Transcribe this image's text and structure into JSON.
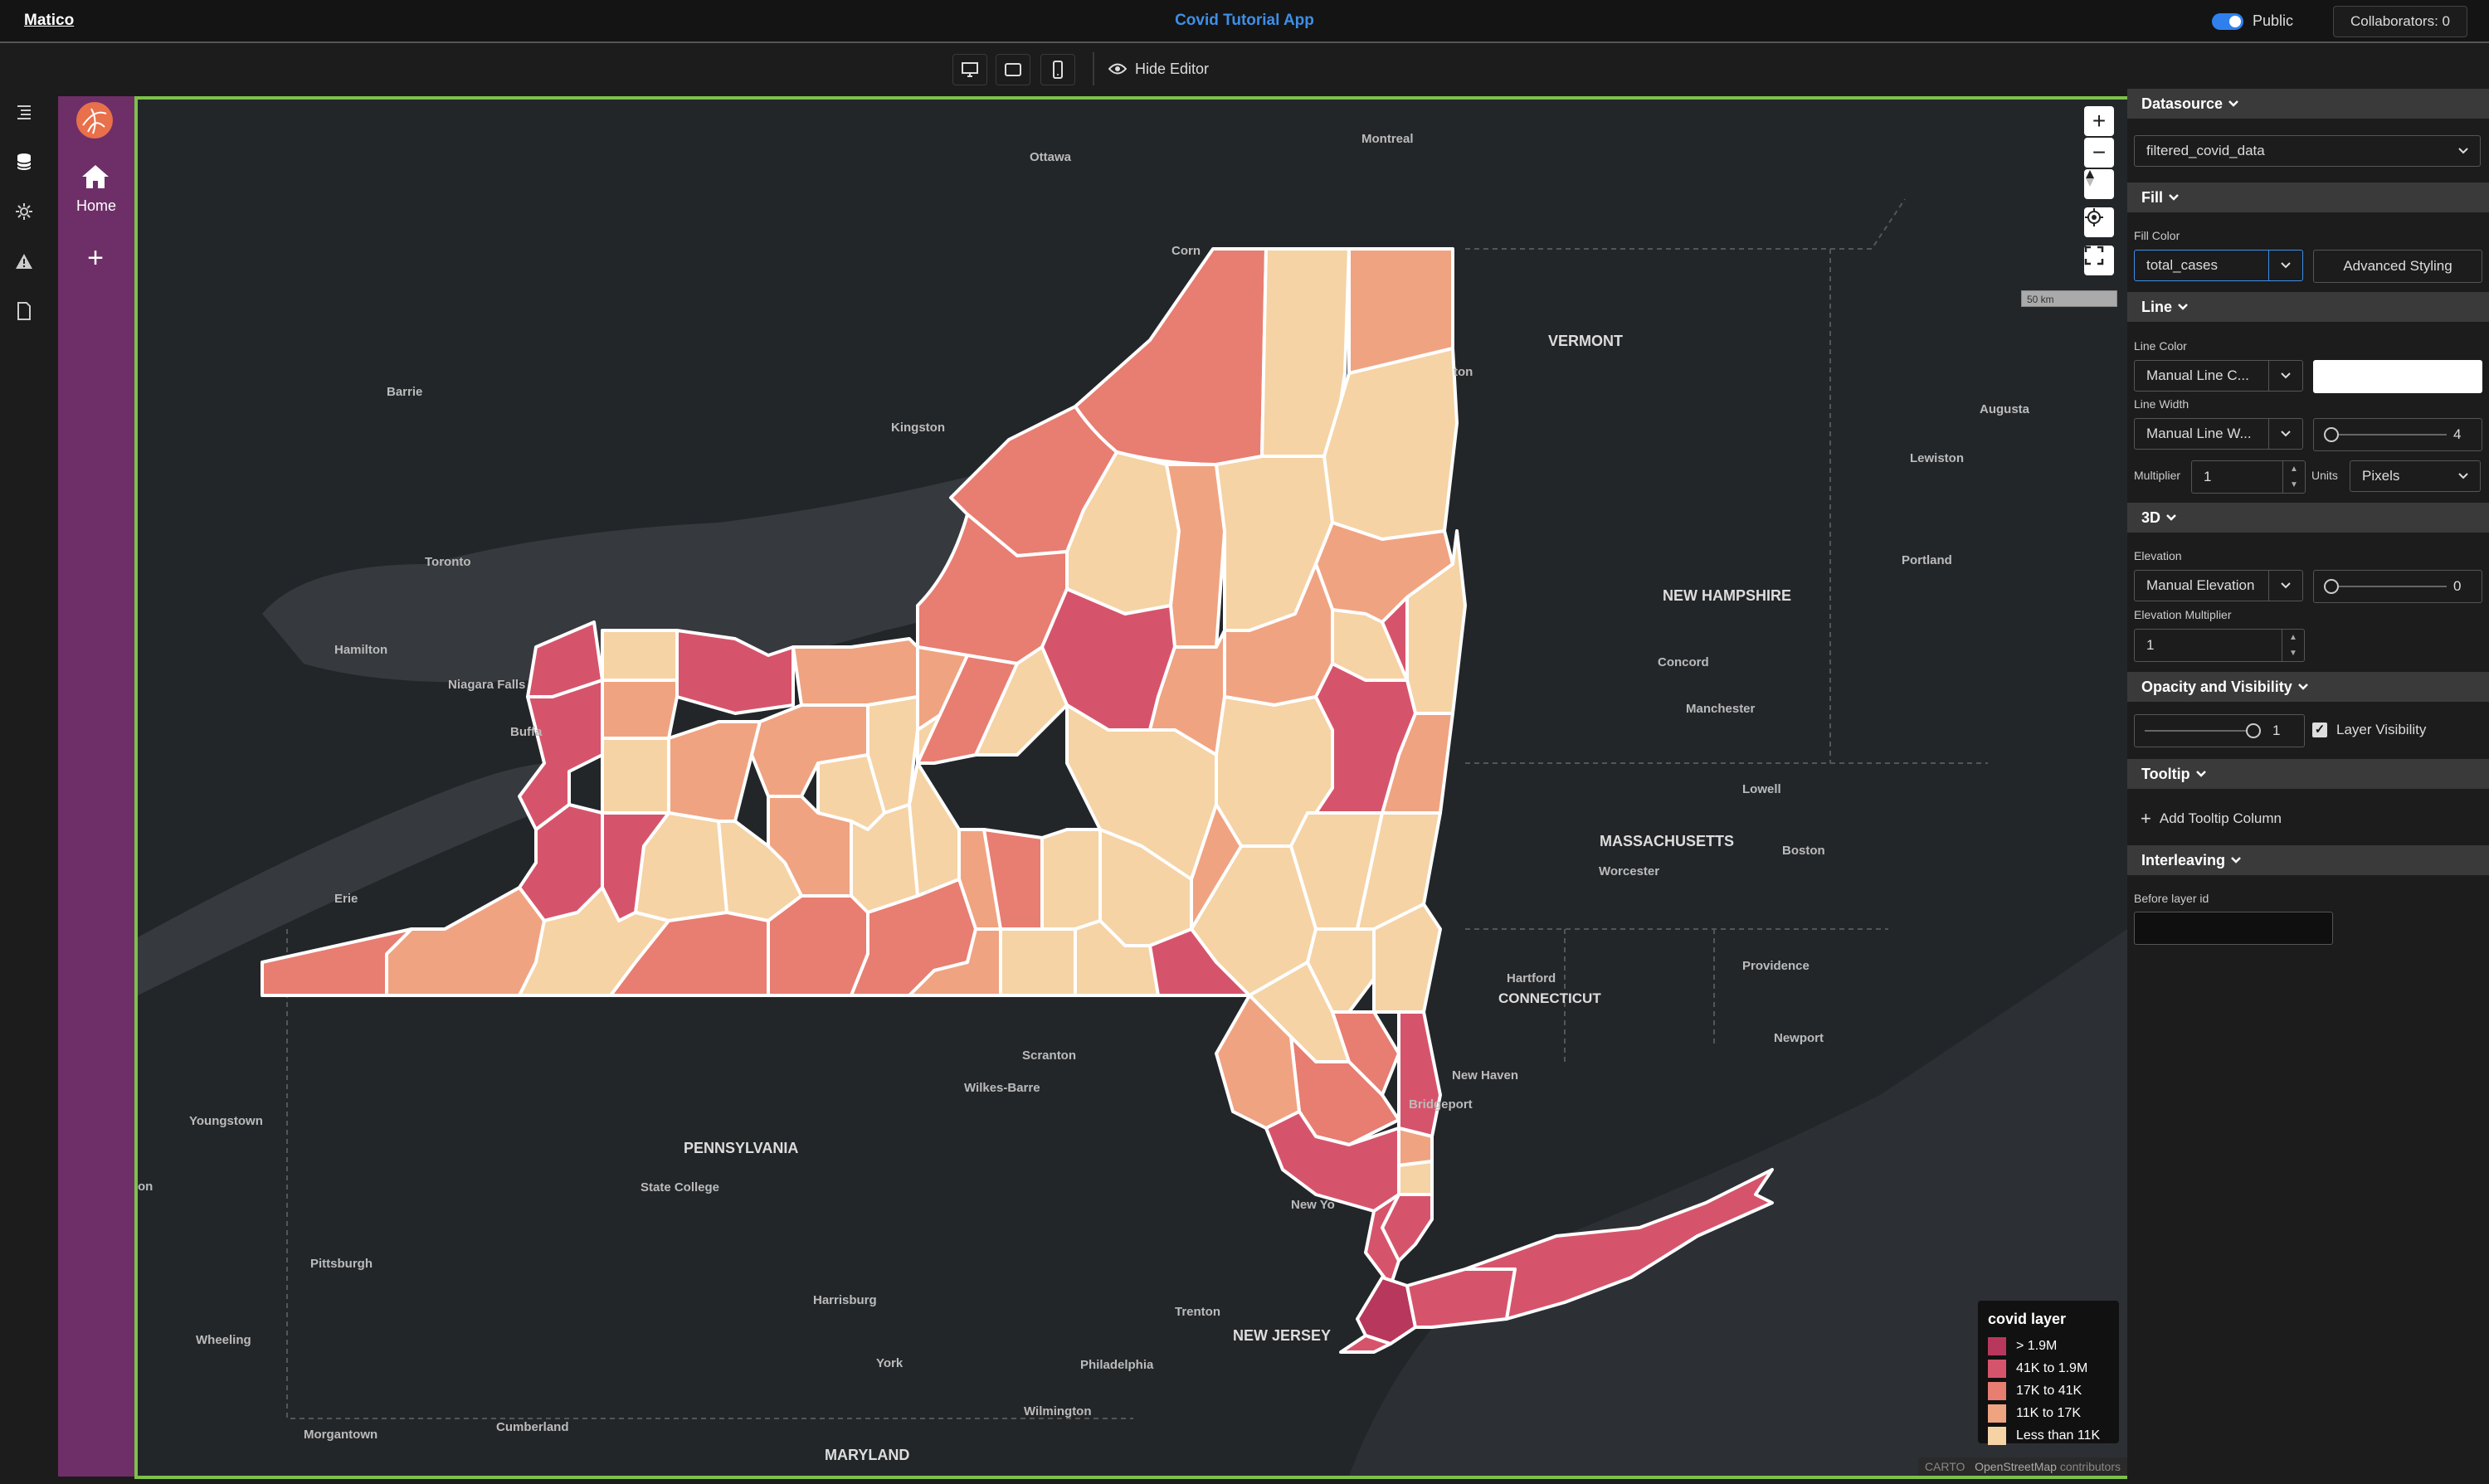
{
  "topbar": {
    "brand": "Matico",
    "app_title": "Covid Tutorial App",
    "public_label": "Public",
    "collaborators": "Collaborators: 0"
  },
  "toolbar": {
    "hide_editor": "Hide Editor"
  },
  "pages": {
    "home_label": "Home"
  },
  "map": {
    "scale_label": "50 km",
    "place_labels": [
      "Ottawa",
      "Montreal",
      "VERMONT",
      "Barrie",
      "Kingston",
      "Augusta",
      "Lewiston",
      "Toronto",
      "Portland",
      "Hamilton",
      "Niagara Falls",
      "Buffa",
      "NEW HAMPSHIRE",
      "Concord",
      "Manchester",
      "Lowell",
      "MASSACHUSETTS",
      "Worcester",
      "Boston",
      "Erie",
      "Providence",
      "Hartford",
      "CONNECTICUT",
      "Newport",
      "Scranton",
      "Wilkes-Barre",
      "New Haven",
      "Bridgeport",
      "Youngstown",
      "PENNSYLVANIA",
      "State College",
      "Pittsburgh",
      "Harrisburg",
      "Trenton",
      "NEW JERSEY",
      "New Yo",
      "Wheeling",
      "York",
      "Philadelphia",
      "Wilmington",
      "Morgantown",
      "Cumberland",
      "MARYLAND",
      "Corn",
      "ton",
      "on"
    ],
    "legend": {
      "title": "covid layer",
      "items": [
        {
          "label": "> 1.9M",
          "color": "#b8375d"
        },
        {
          "label": "41K to 1.9M",
          "color": "#d6546b"
        },
        {
          "label": "17K to 41K",
          "color": "#e87d71"
        },
        {
          "label": "11K to 17K",
          "color": "#f0a381"
        },
        {
          "label": "Less than 11K",
          "color": "#f5d3a5"
        }
      ]
    },
    "attribution": {
      "carto": "CARTO",
      "osm": "OpenStreetMap",
      "contributors": "contributors"
    }
  },
  "panel": {
    "datasource": {
      "heading": "Datasource",
      "value": "filtered_covid_data"
    },
    "fill": {
      "heading": "Fill",
      "fill_color_label": "Fill Color",
      "fill_color_value": "total_cases",
      "advanced_styling": "Advanced Styling"
    },
    "line": {
      "heading": "Line",
      "line_color_label": "Line Color",
      "line_color_value": "Manual Line C...",
      "line_color_swatch": "#ffffff",
      "line_width_label": "Line Width",
      "line_width_value": "Manual Line W...",
      "line_width_slider": "4",
      "multiplier_label": "Multiplier",
      "multiplier_value": "1",
      "units_label": "Units",
      "units_value": "Pixels"
    },
    "three_d": {
      "heading": "3D",
      "elevation_label": "Elevation",
      "elevation_value": "Manual Elevation",
      "elevation_slider": "0",
      "elevation_multiplier_label": "Elevation Multiplier",
      "elevation_multiplier_value": "1"
    },
    "opacity": {
      "heading": "Opacity and Visibility",
      "opacity_value": "1",
      "layer_visibility": "Layer Visibility"
    },
    "tooltip": {
      "heading": "Tooltip",
      "add_column": "Add Tooltip Column"
    },
    "interleaving": {
      "heading": "Interleaving",
      "before_layer_label": "Before layer id",
      "before_layer_value": ""
    }
  },
  "colors": {
    "accent": "#3d8fe8",
    "map_border": "#7cc24a",
    "page_bar": "#6e2f68"
  }
}
